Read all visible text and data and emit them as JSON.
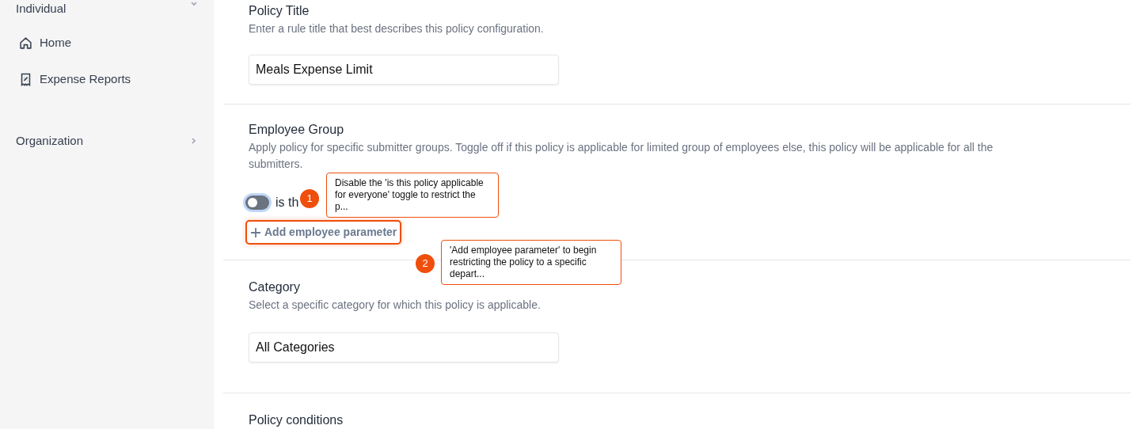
{
  "sidebar": {
    "group": "Individual",
    "items": [
      {
        "label": "Home"
      },
      {
        "label": "Expense Reports"
      }
    ],
    "sections": [
      {
        "label": "Organization"
      }
    ]
  },
  "form": {
    "policy_title": {
      "heading": "Policy Title",
      "description": "Enter a rule title that best describes this policy configuration.",
      "value": "Meals Expense Limit"
    },
    "employee_group": {
      "heading": "Employee Group",
      "description": "Apply policy for specific submitter groups. Toggle off if this policy is applicable for limited group of employees else, this policy will be applicable for all the submitters.",
      "toggle": {
        "label": "is th",
        "on": false
      },
      "add_button": {
        "label": "Add employee parameter",
        "highlighted": true
      }
    },
    "category": {
      "heading": "Category",
      "description": "Select a specific category for which this policy is applicable.",
      "value": "All Categories"
    },
    "policy_conditions": {
      "heading": "Policy conditions"
    }
  },
  "callouts": [
    {
      "number": "1",
      "text": "Disable the 'is this policy applicable for everyone' toggle to restrict the p..."
    },
    {
      "number": "2",
      "text": "'Add employee parameter' to begin restricting the policy to a specific depart..."
    }
  ]
}
